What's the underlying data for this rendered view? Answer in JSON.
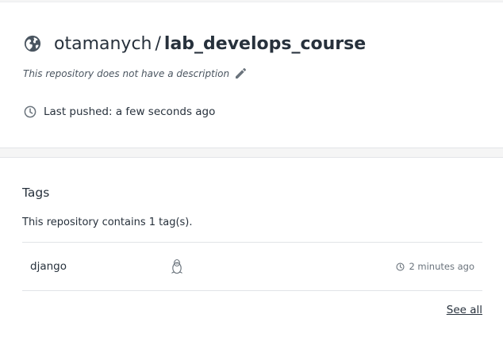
{
  "repository": {
    "owner": "otamanych",
    "separator": "/",
    "name": "lab_develops_course",
    "description": "This repository does not have a description",
    "last_pushed": "Last pushed: a few seconds ago"
  },
  "tags": {
    "heading": "Tags",
    "count_text": "This repository contains 1 tag(s).",
    "items": [
      {
        "name": "django",
        "os_icon": "linux-tux-icon",
        "time": "2 minutes ago"
      }
    ],
    "see_all_label": "See all"
  },
  "colors": {
    "text": "#27313c",
    "muted": "#6a737c",
    "background": "#f5f5f5",
    "card": "#ffffff"
  }
}
